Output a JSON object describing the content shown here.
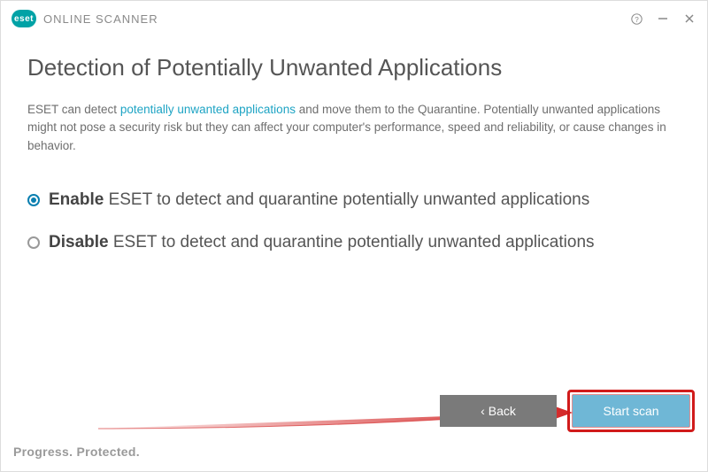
{
  "titlebar": {
    "brand_logo_text": "eset",
    "brand": "ONLINE SCANNER"
  },
  "page": {
    "title": "Detection of Potentially Unwanted Applications",
    "desc_pre": "ESET can detect ",
    "desc_link": "potentially unwanted applications",
    "desc_post": " and move them to the Quarantine. Potentially unwanted applications might not pose a security risk but they can affect your computer's performance, speed and reliability, or cause changes in behavior."
  },
  "options": {
    "enable_bold": "Enable",
    "enable_rest": " ESET to detect and quarantine potentially unwanted applications",
    "disable_bold": "Disable",
    "disable_rest": " ESET to detect and quarantine potentially unwanted applications"
  },
  "buttons": {
    "back": "Back",
    "start": "Start scan"
  },
  "footer": {
    "tagline": "Progress. Protected."
  },
  "colors": {
    "accent": "#0a7fb0",
    "link": "#1ea4c4",
    "start_btn": "#6fb7d6",
    "back_btn": "#7a7a7a",
    "highlight": "#d11b1b"
  }
}
